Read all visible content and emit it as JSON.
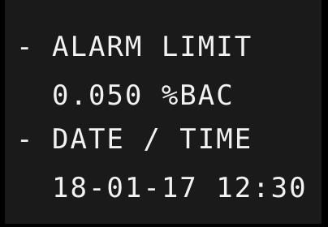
{
  "menu": {
    "items": [
      {
        "marker": "-",
        "label": "ALARM LIMIT",
        "value": "0.050 %BAC"
      },
      {
        "marker": "-",
        "label": "DATE / TIME",
        "value": "18-01-17 12:30"
      }
    ]
  },
  "colors": {
    "background": "#1a1a1a",
    "border": "#000000",
    "text": "#f2f2f2"
  }
}
